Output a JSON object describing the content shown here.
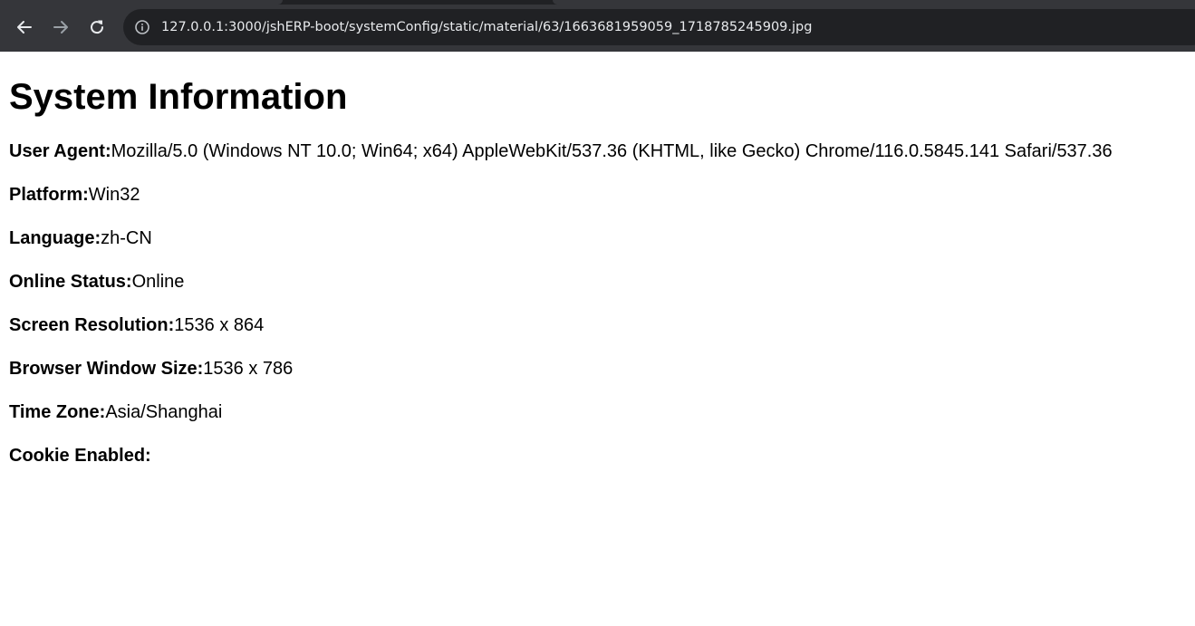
{
  "browser": {
    "url": "127.0.0.1:3000/jshERP-boot/systemConfig/static/material/63/1663681959059_1718785245909.jpg",
    "icons": {
      "back": "back-arrow-icon",
      "forward": "forward-arrow-icon",
      "reload": "reload-icon",
      "site_info": "info-icon"
    },
    "colors": {
      "toolbar": "#35363a",
      "omnibox": "#202124",
      "url_text": "#e8eaed"
    }
  },
  "page": {
    "title": "System Information",
    "rows": [
      {
        "label": "User Agent:",
        "value": "Mozilla/5.0 (Windows NT 10.0; Win64; x64) AppleWebKit/537.36 (KHTML, like Gecko) Chrome/116.0.5845.141 Safari/537.36"
      },
      {
        "label": "Platform:",
        "value": "Win32"
      },
      {
        "label": "Language:",
        "value": "zh-CN"
      },
      {
        "label": "Online Status:",
        "value": "Online"
      },
      {
        "label": "Screen Resolution:",
        "value": "1536 x 864"
      },
      {
        "label": "Browser Window Size:",
        "value": "1536 x 786"
      },
      {
        "label": "Time Zone:",
        "value": "Asia/Shanghai"
      },
      {
        "label": "Cookie Enabled:",
        "value": ""
      }
    ]
  }
}
